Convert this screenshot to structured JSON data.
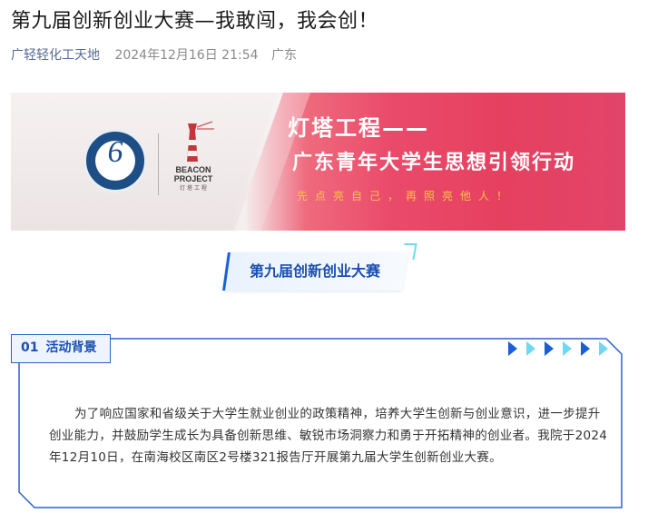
{
  "article": {
    "title": "第九届创新创业大赛—我敢闯，我会创！",
    "account": "广轻轻化工天地",
    "date": "2024年12月16日 21:54",
    "location": "广东"
  },
  "banner": {
    "heading1": "灯塔工程——",
    "heading2": "广东青年大学生思想引领行动",
    "slogan": "先点亮自己，再照亮他人！",
    "beacon_title": "BEACON PROJECT",
    "beacon_sub": "灯 塔 工 程",
    "colors": {
      "accent": "#e6405f",
      "slogan": "#f8c34a"
    }
  },
  "section": {
    "title": "第九届创新创业大赛"
  },
  "card": {
    "tag_number": "01",
    "tag_label": "活动背景",
    "paragraph": "为了响应国家和省级关于大学生就业创业的政策精神，培养大学生创新与创业意识，进一步提升创业能力，并鼓励学生成长为具备创新思维、敏锐市场洞察力和勇于开拓精神的创业者。我院于2024年12月10日，在南海校区南区2号楼321报告厅开展第九届大学生创新创业大赛。",
    "colors": {
      "border": "#2b63c8",
      "arrow_dark": "#1a5fd8",
      "arrow_light": "#6fd8f2"
    }
  }
}
